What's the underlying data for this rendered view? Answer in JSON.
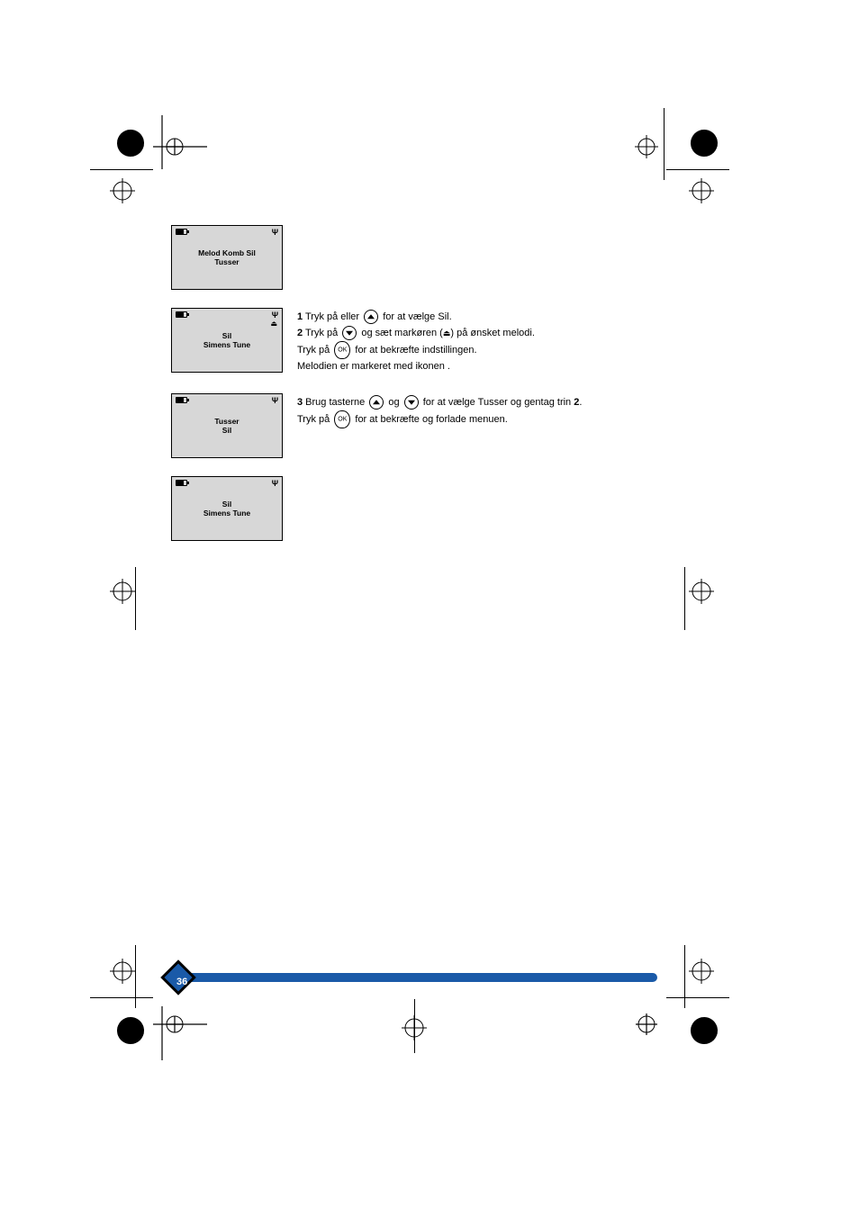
{
  "header_note": "",
  "screens": [
    {
      "text": "Melod Komb Sil \n Tusser"
    },
    {
      "text": "Sil                   \nSimens Tune"
    },
    {
      "text": "Tusser                \nSil"
    },
    {
      "text": "Sil                   \nSimens Tune"
    }
  ],
  "steps": {
    "step1": {
      "num": "1",
      "text_a": " Tryk på eller ",
      "text_b": " for at vælge Sil."
    },
    "step2": {
      "num": "2",
      "line1_a": " Tryk på ",
      "line1_b": " og sæt markøren (",
      "line1_c": ") på ønsket melodi.",
      "line2_a": "Tryk på ",
      "line2_b": " for at bekræfte indstillingen.",
      "line3": "Melodien er markeret med ikonen ."
    },
    "step3": {
      "num": "3",
      "line1_a": " Brug tasterne ",
      "line1_b": " og ",
      "line1_c": " for at vælge Tusser og gentag trin",
      "bold_ref": "2",
      "line2_a": "Tryk på ",
      "line2_b": " for at bekræfte og forlade menuen."
    }
  },
  "page_number": "36",
  "icons": {
    "ok_label": "OK"
  }
}
